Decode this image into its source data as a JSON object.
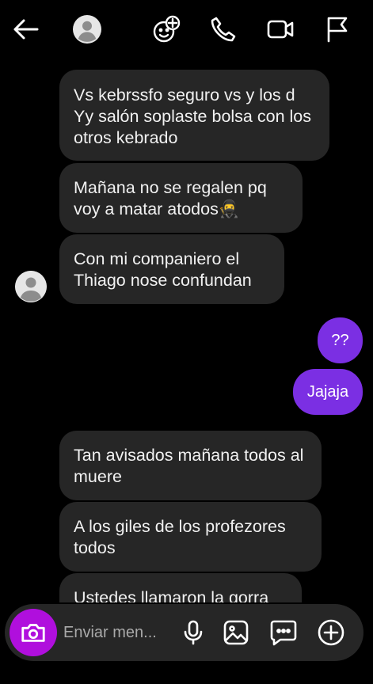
{
  "header": {
    "back_icon": "arrow-left-icon",
    "avatar_icon": "default-avatar-icon",
    "icons": [
      "add-effect-icon",
      "phone-icon",
      "video-icon",
      "flag-icon"
    ]
  },
  "messages": [
    {
      "from": "them",
      "text": "Vs kebrssfo seguro vs y los d Yy salón soplaste bolsa con los otros kebrado"
    },
    {
      "from": "them",
      "text": "Mañana no se regalen pq voy a matar atodos🥷"
    },
    {
      "from": "them",
      "text": "Con mi companiero el Thiago nose confundan"
    },
    {
      "from": "me",
      "text": "??"
    },
    {
      "from": "me",
      "text": "Jajaja"
    },
    {
      "from": "them",
      "text": "Tan avisados mañana todos al muere"
    },
    {
      "from": "them",
      "text": "A los giles de los profezores todos"
    },
    {
      "from": "them",
      "text": "Ustedes llamaron la gorra"
    }
  ],
  "composer": {
    "placeholder": "Enviar men...",
    "camera_icon": "camera-icon",
    "icons": [
      "microphone-icon",
      "gallery-icon",
      "sticker-chat-icon",
      "add-icon"
    ]
  },
  "colors": {
    "background": "#000000",
    "incoming_bubble": "#262626",
    "outgoing_bubble": "#7b2fe3",
    "camera_button": "#b00fdd"
  }
}
